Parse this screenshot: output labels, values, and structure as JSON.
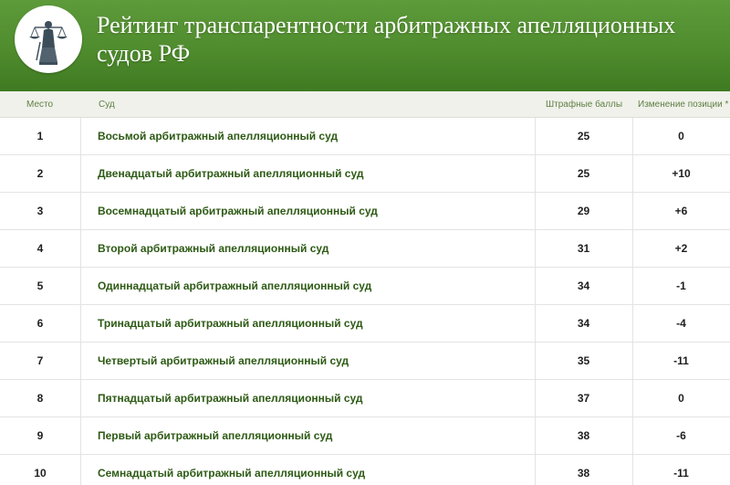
{
  "header": {
    "title": "Рейтинг транспарентности арбитражных апелляционных судов РФ"
  },
  "columns": {
    "place": "Место",
    "court": "Суд",
    "score": "Штрафные баллы",
    "change": "Изменение позиции *"
  },
  "rows": [
    {
      "place": "1",
      "court": "Восьмой арбитражный апелляционный суд",
      "score": "25",
      "change": "0"
    },
    {
      "place": "2",
      "court": "Двенадцатый арбитражный апелляционный суд",
      "score": "25",
      "change": "+10"
    },
    {
      "place": "3",
      "court": "Восемнадцатый арбитражный апелляционный суд",
      "score": "29",
      "change": "+6"
    },
    {
      "place": "4",
      "court": "Второй арбитражный апелляционный суд",
      "score": "31",
      "change": "+2"
    },
    {
      "place": "5",
      "court": "Одиннадцатый арбитражный апелляционный суд",
      "score": "34",
      "change": "-1"
    },
    {
      "place": "6",
      "court": "Тринадцатый арбитражный апелляционный суд",
      "score": "34",
      "change": "-4"
    },
    {
      "place": "7",
      "court": "Четвертый арбитражный апелляционный суд",
      "score": "35",
      "change": "-11"
    },
    {
      "place": "8",
      "court": "Пятнадцатый арбитражный апелляционный суд",
      "score": "37",
      "change": "0"
    },
    {
      "place": "9",
      "court": "Первый арбитражный апелляционный суд",
      "score": "38",
      "change": "-6"
    },
    {
      "place": "10",
      "court": "Семнадцатый арбитражный апелляционный суд",
      "score": "38",
      "change": "-11"
    }
  ],
  "colors": {
    "header_green": "#4f8c2d",
    "court_text": "#2d5a14",
    "column_header_text": "#5f7f45"
  },
  "icons": {
    "logo": "themis-justice-icon"
  }
}
